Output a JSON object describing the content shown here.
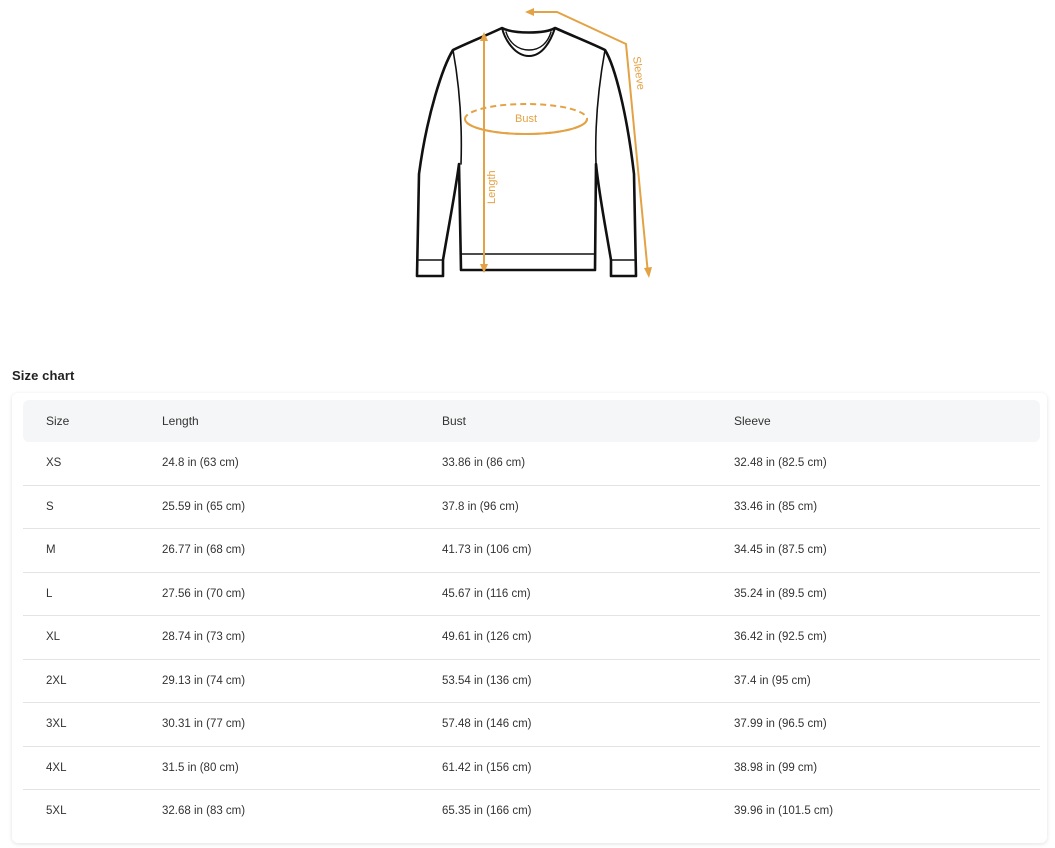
{
  "diagram": {
    "labels": {
      "bust": "Bust",
      "length": "Length",
      "sleeve": "Sleeve"
    },
    "accent_color": "#e3a244"
  },
  "size_chart": {
    "title": "Size chart",
    "headers": [
      "Size",
      "Length",
      "Bust",
      "Sleeve"
    ],
    "rows": [
      [
        "XS",
        "24.8 in  (63 cm)",
        "33.86 in  (86 cm)",
        "32.48 in  (82.5 cm)"
      ],
      [
        "S",
        "25.59 in  (65 cm)",
        "37.8 in  (96 cm)",
        "33.46 in  (85 cm)"
      ],
      [
        "M",
        "26.77 in  (68 cm)",
        "41.73 in  (106 cm)",
        "34.45 in  (87.5 cm)"
      ],
      [
        "L",
        "27.56 in  (70 cm)",
        "45.67 in  (116 cm)",
        "35.24 in  (89.5 cm)"
      ],
      [
        "XL",
        "28.74 in  (73 cm)",
        "49.61 in  (126 cm)",
        "36.42 in  (92.5 cm)"
      ],
      [
        "2XL",
        "29.13 in  (74 cm)",
        "53.54 in  (136 cm)",
        "37.4 in  (95 cm)"
      ],
      [
        "3XL",
        "30.31 in  (77 cm)",
        "57.48 in  (146 cm)",
        "37.99 in  (96.5 cm)"
      ],
      [
        "4XL",
        "31.5 in  (80 cm)",
        "61.42 in  (156 cm)",
        "38.98 in  (99 cm)"
      ],
      [
        "5XL",
        "32.68 in  (83 cm)",
        "65.35 in  (166 cm)",
        "39.96 in  (101.5 cm)"
      ]
    ]
  }
}
